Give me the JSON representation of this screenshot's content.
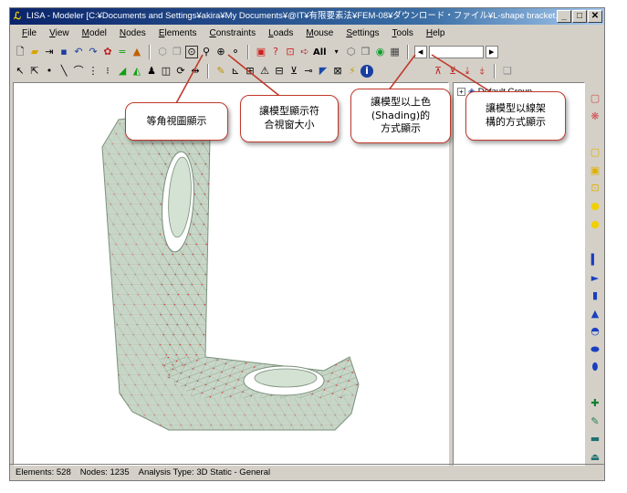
{
  "window": {
    "title": "LISA - Modeler [C:¥Documents and Settings¥akira¥My Documents¥@IT¥有限要素法¥FEM-08¥ダウンロード・ファイル¥L-shape bracket.vol]",
    "controls": {
      "minimize": "_",
      "maximize": "□",
      "close": "✕"
    }
  },
  "menu": [
    "File",
    "View",
    "Model",
    "Nodes",
    "Elements",
    "Constraints",
    "Loads",
    "Mouse",
    "Settings",
    "Tools",
    "Help"
  ],
  "toolbar": {
    "display_mode": "All"
  },
  "tree": {
    "root_label": "Default Group",
    "expander": "+"
  },
  "status": {
    "elements": "Elements: 528",
    "nodes": "Nodes: 1235",
    "analysis": "Analysis Type: 3D Static - General"
  },
  "annotations": {
    "isometric": "等角視圖顯示",
    "fit_window_1": "讓模型顯示符",
    "fit_window_2": "合視窗大小",
    "shading_1": "讓模型以上色",
    "shading_2": "(Shading)的",
    "shading_3": "方式顯示",
    "wireframe_1": "讓模型以線架",
    "wireframe_2": "構的方式顯示"
  },
  "colors": {
    "mesh_fill": "#cfe0cf",
    "node_red": "#e01010",
    "callout_border": "#c0392b",
    "title_blue": "#0a246a"
  }
}
